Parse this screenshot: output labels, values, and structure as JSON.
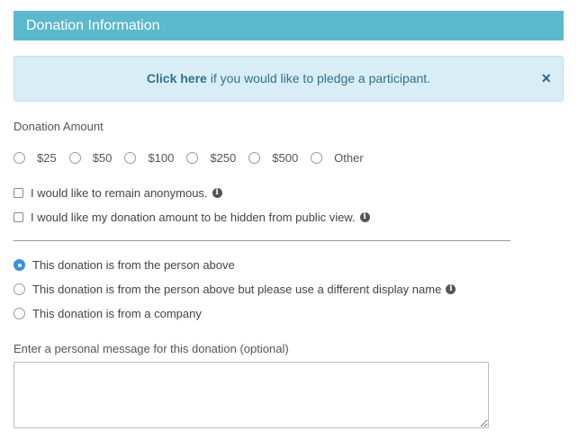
{
  "header": {
    "title": "Donation Information"
  },
  "alert": {
    "link_text": "Click here",
    "text": " if you would like to pledge a participant.",
    "close_label": "×"
  },
  "donation_amount": {
    "label": "Donation Amount",
    "options": [
      "$25",
      "$50",
      "$100",
      "$250",
      "$500",
      "Other"
    ]
  },
  "checkboxes": {
    "anonymous": "I would like to remain anonymous.",
    "hide_amount": "I would like my donation amount to be hidden from public view."
  },
  "source": {
    "person": "This donation is from the person above",
    "display_name": "This donation is from the person above but please use a different display name",
    "company": "This donation is from a company",
    "selected": "person"
  },
  "message": {
    "label": "Enter a personal message for this donation (optional)",
    "value": ""
  },
  "colors": {
    "header_bg": "#5bb8cd",
    "alert_bg": "#d9edf6",
    "alert_text": "#31708f",
    "radio_selected": "#3a8ee6"
  }
}
